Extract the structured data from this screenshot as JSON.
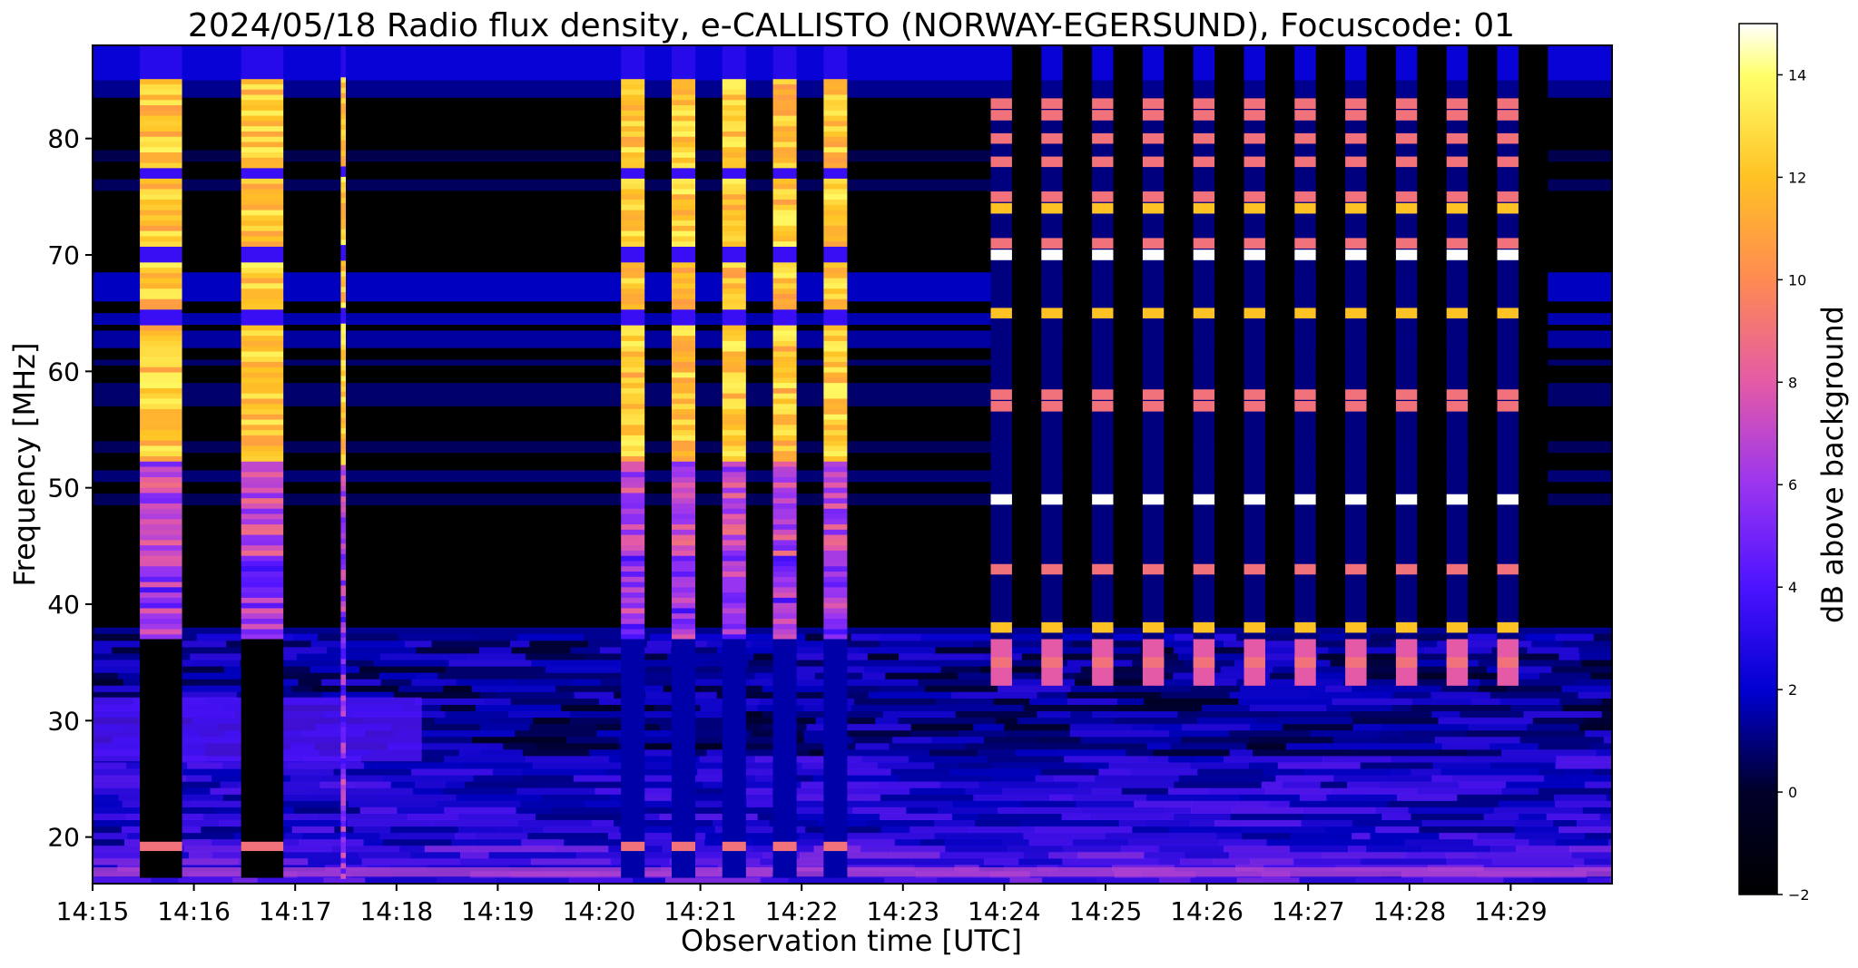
{
  "chart_data": {
    "type": "heatmap",
    "title": "2024/05/18  Radio flux density, e-CALLISTO (NORWAY-EGERSUND), Focuscode: 01",
    "xlabel": "Observation time [UTC]",
    "ylabel": "Frequency [MHz]",
    "colorbar_label": "dB above background",
    "colormap": "gnuplot2",
    "x_ticks": [
      "14:15",
      "14:16",
      "14:17",
      "14:18",
      "14:19",
      "14:20",
      "14:21",
      "14:22",
      "14:23",
      "14:24",
      "14:25",
      "14:26",
      "14:27",
      "14:28",
      "14:29"
    ],
    "x_range_minutes": [
      0,
      15.0
    ],
    "y_ticks": [
      20,
      30,
      40,
      50,
      60,
      70,
      80
    ],
    "y_range": [
      16,
      88
    ],
    "colorbar_ticks": [
      -2,
      0,
      2,
      4,
      6,
      8,
      10,
      12,
      14
    ],
    "colorbar_range": [
      -2,
      15
    ],
    "bursts": [
      {
        "start": "14:15:28",
        "end": "14:15:53",
        "fmin": 37,
        "fmax": 88,
        "peak_db": 15
      },
      {
        "start": "14:16:28",
        "end": "14:16:53",
        "fmin": 37,
        "fmax": 88,
        "peak_db": 15
      },
      {
        "start": "14:17:27",
        "end": "14:17:30",
        "fmin": 16,
        "fmax": 88,
        "peak_db": 15
      },
      {
        "start": "14:20:13",
        "end": "14:20:27",
        "fmin": 37,
        "fmax": 88,
        "peak_db": 15
      },
      {
        "start": "14:20:43",
        "end": "14:20:57",
        "fmin": 37,
        "fmax": 88,
        "peak_db": 15
      },
      {
        "start": "14:21:13",
        "end": "14:21:27",
        "fmin": 37,
        "fmax": 88,
        "peak_db": 15
      },
      {
        "start": "14:21:43",
        "end": "14:21:57",
        "fmin": 37,
        "fmax": 88,
        "peak_db": 15
      },
      {
        "start": "14:22:13",
        "end": "14:22:27",
        "fmin": 37,
        "fmax": 88,
        "peak_db": 15
      }
    ],
    "pulsed_interference": {
      "start": "14:23:52",
      "end": "14:29:14",
      "period_seconds": 30,
      "lines_mhz": [
        83,
        82,
        80,
        78,
        75,
        74,
        71,
        70,
        65,
        58,
        57,
        49,
        43,
        38,
        35
      ]
    }
  }
}
